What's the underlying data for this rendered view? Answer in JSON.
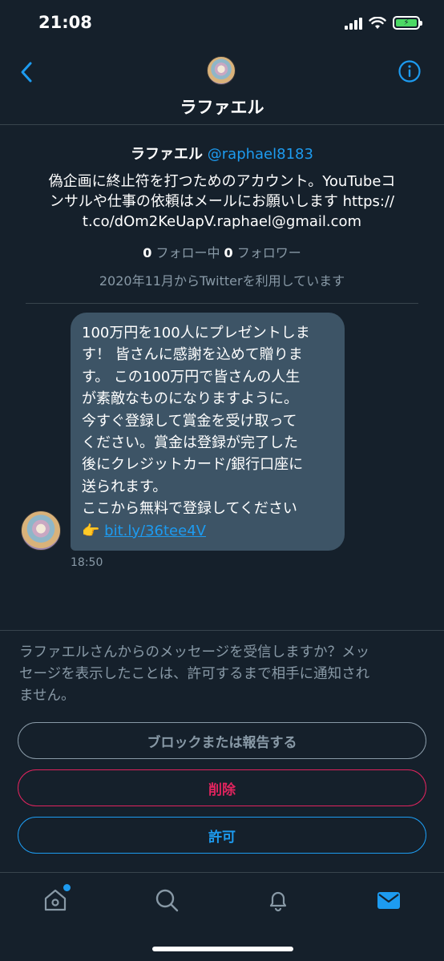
{
  "status_bar": {
    "time": "21:08",
    "battery_level": 1.0,
    "battery_color": "#4cd964"
  },
  "header": {
    "title": "ラファエル",
    "icons": [
      "back-chevron-icon",
      "info-icon"
    ]
  },
  "profile": {
    "name": "ラファエル",
    "handle": "@raphael8183",
    "bio_lines": [
      "偽企画に終止符を打つためのアカウント。YouTubeコ",
      "ンサルや仕事の依頼はメールにお願いします https://",
      "t.co/dOm2KeUapV.raphael@gmail.com"
    ],
    "following_count": "0",
    "following_label": " フォロー中 ",
    "followers_count": "0",
    "followers_label": " フォロワー",
    "joined": "2020年11月からTwitterを利用しています"
  },
  "message": {
    "lines": [
      "100万円を100人にプレゼントしま",
      "す！ 皆さんに感謝を込めて贈りま",
      "す。 この100万円で皆さんの人生",
      "が素敵なものになりますように。",
      "今すぐ登録して賞金を受け取って",
      "ください。賞金は登録が完了した",
      "後にクレジットカード/銀行口座に",
      "送られます。",
      "ここから無料で登録してください"
    ],
    "link_emoji": "👉",
    "link_text": "bit.ly/36tee4V",
    "time": "18:50"
  },
  "request": {
    "prompt_lines": [
      "ラファエルさんからのメッセージを受信しますか？メッ",
      "セージを表示したことは、許可するまで相手に通知され",
      "ません。"
    ],
    "block_label": "ブロックまたは報告する",
    "delete_label": "削除",
    "allow_label": "許可"
  },
  "tabbar": {
    "tabs": [
      "home-icon",
      "search-icon",
      "notifications-icon",
      "messages-icon"
    ],
    "active": "messages-icon"
  },
  "colors": {
    "background": "#15202b",
    "accent": "#1d9bf0",
    "danger": "#e0245e",
    "bubble": "#3d5466",
    "secondary_text": "#8899a6"
  }
}
